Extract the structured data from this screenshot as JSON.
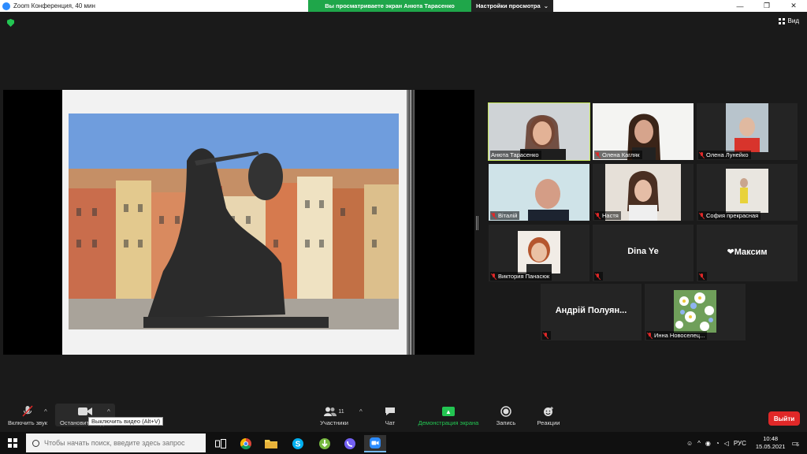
{
  "titlebar": {
    "title": "Zoom Конференция, 40 мин",
    "share_banner": "Вы просматриваете экран Анюта Тарасенко",
    "view_settings": "Настройки просмотра",
    "view_settings_caret": "⌄",
    "minimize": "—",
    "maximize": "❐",
    "close": "✕"
  },
  "view_button": {
    "label": "Вид"
  },
  "participants": [
    {
      "name": "Анюта Тарасенко",
      "muted": false,
      "active": true,
      "type": "video"
    },
    {
      "name": "Олена Кагляк",
      "muted": true,
      "type": "video"
    },
    {
      "name": "Олена Лунейко",
      "muted": true,
      "type": "video"
    },
    {
      "name": "Віталій",
      "muted": true,
      "type": "video"
    },
    {
      "name": "Настя",
      "muted": true,
      "type": "video"
    },
    {
      "name": "София прекрасная",
      "muted": true,
      "type": "video"
    },
    {
      "name": "Виктория Панасюк",
      "muted": true,
      "type": "photo"
    },
    {
      "name": "Dina Ye",
      "muted": true,
      "type": "name"
    },
    {
      "name": "❤Максим",
      "muted": true,
      "type": "name"
    },
    {
      "name": "Андрій Полуян...",
      "muted": true,
      "type": "name"
    },
    {
      "name": "Инна Новоселец...",
      "muted": true,
      "type": "photo"
    }
  ],
  "toolbar": {
    "unmute": "Включить звук",
    "stop_video": "Остановить видео",
    "tooltip": "Выключить видео (Alt+V)",
    "participants": "Участники",
    "participants_count": "11",
    "chat": "Чат",
    "share_screen": "Демонстрация экрана",
    "record": "Запись",
    "reactions": "Реакции",
    "leave": "Выйти",
    "caret": "^"
  },
  "taskbar": {
    "search_placeholder": "Чтобы начать поиск, введите здесь запрос",
    "lang": "РУС",
    "time": "10:48",
    "date": "15.05.2021",
    "notifications": "5"
  },
  "colors": {
    "accent_green": "#1fa64a",
    "active_speaker": "#c7e85c",
    "leave_red": "#e02828",
    "zoom_blue": "#2d8cff"
  }
}
